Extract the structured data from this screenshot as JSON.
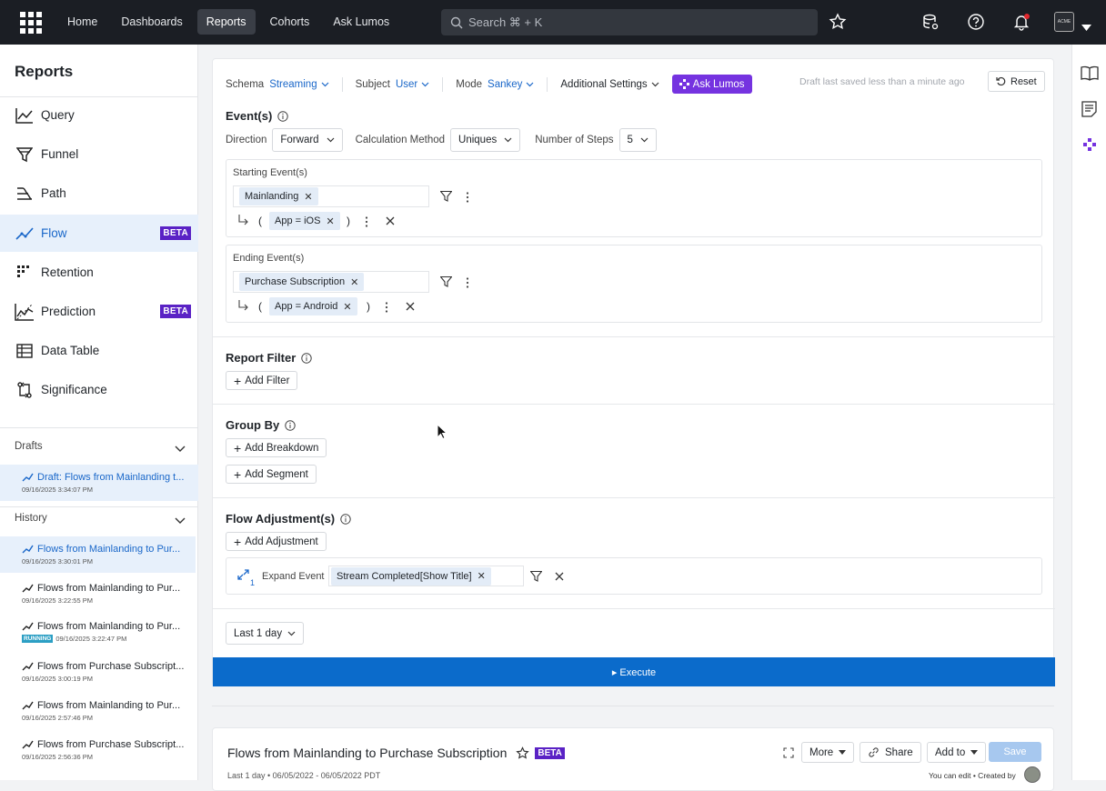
{
  "nav": {
    "home": "Home",
    "dashboards": "Dashboards",
    "reports": "Reports",
    "cohorts": "Cohorts",
    "ask_lumos": "Ask Lumos",
    "search_placeholder": "Search ⌘ + K",
    "avatar_text": "ACME"
  },
  "sidebar": {
    "title": "Reports",
    "items": [
      {
        "label": "Query",
        "icon": "query-chart-icon"
      },
      {
        "label": "Funnel",
        "icon": "funnel-icon"
      },
      {
        "label": "Path",
        "icon": "path-icon"
      },
      {
        "label": "Flow",
        "icon": "flow-icon",
        "badge": "BETA"
      },
      {
        "label": "Retention",
        "icon": "retention-icon"
      },
      {
        "label": "Prediction",
        "icon": "prediction-icon",
        "badge": "BETA"
      },
      {
        "label": "Data Table",
        "icon": "table-icon"
      },
      {
        "label": "Significance",
        "icon": "significance-icon"
      }
    ],
    "drafts_label": "Drafts",
    "draft": {
      "title": "Draft: Flows from Mainlanding t...",
      "date": "09/16/2025 3:34:07 PM"
    },
    "history_label": "History",
    "history": [
      {
        "title": "Flows from Mainlanding to Pur...",
        "date": "09/16/2025 3:30:01 PM"
      },
      {
        "title": "Flows from Mainlanding to Pur...",
        "date": "09/16/2025 3:22:55 PM"
      },
      {
        "title": "Flows from Mainlanding to Pur...",
        "date": "09/16/2025 3:22:47 PM",
        "status": "RUNNING"
      },
      {
        "title": "Flows from Purchase Subscript...",
        "date": "09/16/2025 3:00:19 PM"
      },
      {
        "title": "Flows from Mainlanding to Pur...",
        "date": "09/16/2025 2:57:46 PM"
      },
      {
        "title": "Flows from Purchase Subscript...",
        "date": "09/16/2025 2:56:36 PM"
      }
    ]
  },
  "settings": {
    "schema_label": "Schema",
    "schema_value": "Streaming",
    "subject_label": "Subject",
    "subject_value": "User",
    "mode_label": "Mode",
    "mode_value": "Sankey",
    "additional": "Additional Settings",
    "ask_lumos": "Ask Lumos",
    "draft_status": "Draft last saved less than a minute ago",
    "reset": "Reset"
  },
  "events": {
    "title": "Event(s)",
    "direction_label": "Direction",
    "direction_value": "Forward",
    "calc_label": "Calculation Method",
    "calc_value": "Uniques",
    "steps_label": "Number of Steps",
    "steps_value": "5",
    "starting_label": "Starting Event(s)",
    "starting_event": "Mainlanding",
    "starting_filter": "App = iOS",
    "ending_label": "Ending Event(s)",
    "ending_event": "Purchase Subscription",
    "ending_filter": "App = Android",
    "paren_open": "(",
    "paren_close": ")"
  },
  "report_filter": {
    "title": "Report Filter",
    "add": "Add Filter"
  },
  "group_by": {
    "title": "Group By",
    "add_breakdown": "Add Breakdown",
    "add_segment": "Add Segment"
  },
  "flow_adjust": {
    "title": "Flow Adjustment(s)",
    "add": "Add Adjustment",
    "expand_label": "Expand Event",
    "expand_event": "Stream Completed[Show Title]",
    "step_num": "1"
  },
  "date_range": "Last 1 day",
  "execute": "▸ Execute",
  "result": {
    "title": "Flows from Mainlanding to Purchase Subscription",
    "badge": "BETA",
    "subtitle": "Last 1 day • 06/05/2022 - 06/05/2022 PDT",
    "more": "More",
    "share": "Share",
    "add_to": "Add to",
    "save": "Save",
    "edit_note": "You can edit • Created by"
  }
}
